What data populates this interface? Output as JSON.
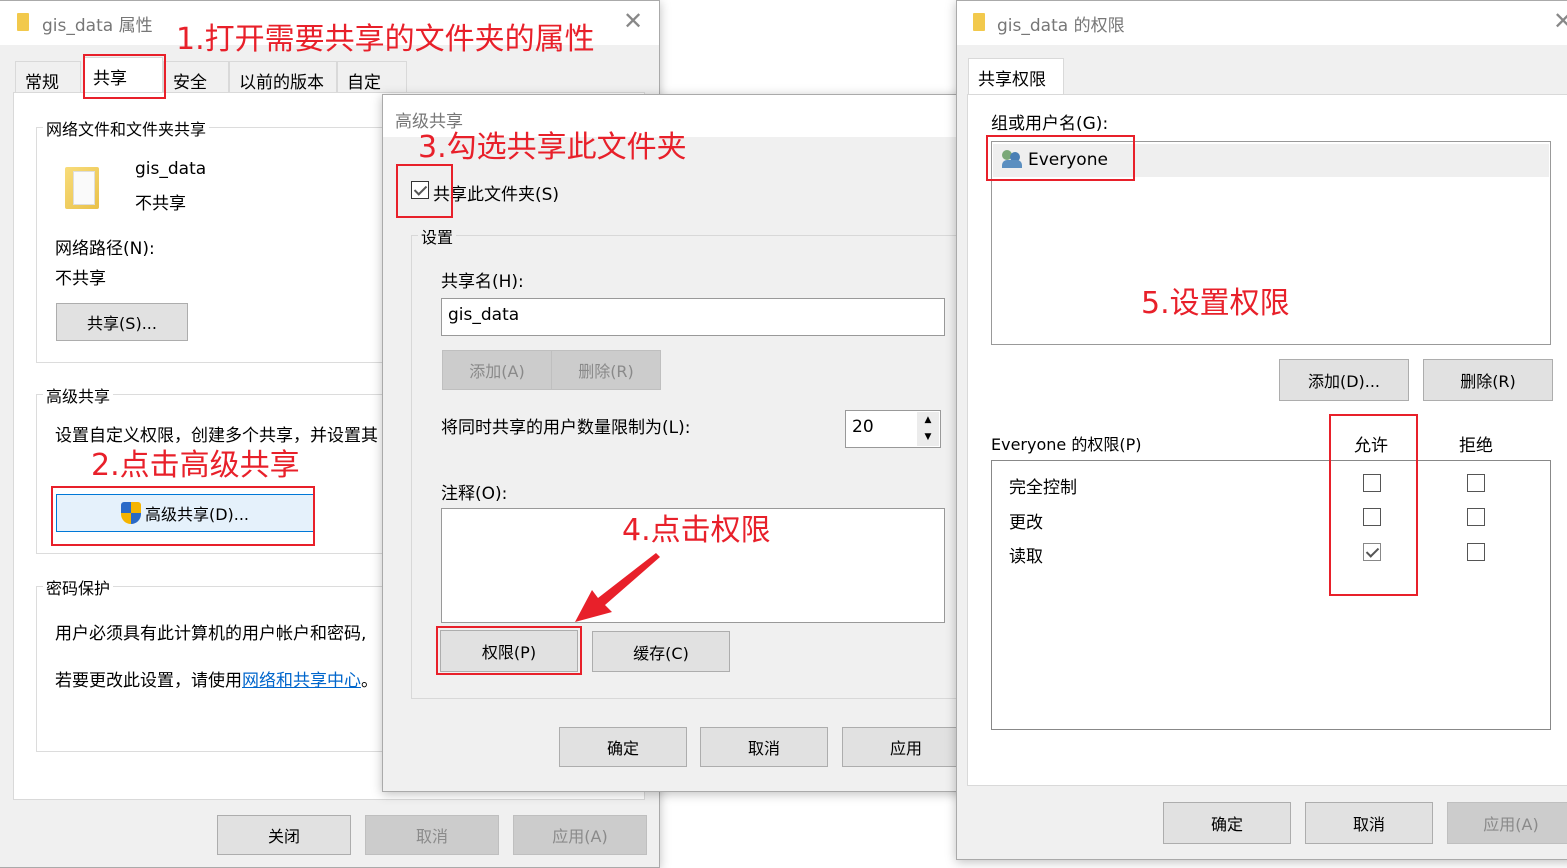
{
  "properties_window": {
    "title": "gis_data 属性",
    "close_glyph": "✕",
    "tabs": [
      {
        "label": "常规",
        "active": false
      },
      {
        "label": "共享",
        "active": true
      },
      {
        "label": "安全",
        "active": false
      },
      {
        "label": "以前的版本",
        "active": false
      },
      {
        "label": "自定义",
        "active": false
      }
    ],
    "network_sharing": {
      "group_label": "网络文件和文件夹共享",
      "folder_name": "gis_data",
      "folder_status": "不共享",
      "network_path_label": "网络路径(N):",
      "network_path_value": "不共享",
      "share_button": "共享(S)..."
    },
    "advanced_sharing": {
      "group_label": "高级共享",
      "description": "设置自定义权限，创建多个共享，并设置其",
      "button": "高级共享(D)..."
    },
    "password_protection": {
      "group_label": "密码保护",
      "line1": "用户必须具有此计算机的用户帐户和密码,",
      "line2_prefix": "若要更改此设置，请使用",
      "line2_link": "网络和共享中心",
      "line2_suffix": "。"
    },
    "footer": {
      "close": "关闭",
      "cancel": "取消",
      "apply": "应用(A)"
    }
  },
  "advanced_dialog": {
    "title": "高级共享",
    "share_checkbox_label": "共享此文件夹(S)",
    "share_checked": true,
    "settings_group": "设置",
    "share_name_label": "共享名(H):",
    "share_name_value": "gis_data",
    "add_button": "添加(A)",
    "remove_button": "删除(R)",
    "user_limit_label": "将同时共享的用户数量限制为(L):",
    "user_limit_value": "20",
    "comment_label": "注释(O):",
    "comment_value": "",
    "permissions_button": "权限(P)",
    "caching_button": "缓存(C)",
    "ok": "确定",
    "cancel": "取消",
    "apply": "应用"
  },
  "permissions_dialog": {
    "title": "gis_data 的权限",
    "tab": "共享权限",
    "group_label": "组或用户名(G):",
    "users": [
      "Everyone"
    ],
    "add_button": "添加(D)...",
    "remove_button": "删除(R)",
    "perm_label": "Everyone 的权限(P)",
    "allow_header": "允许",
    "deny_header": "拒绝",
    "permissions": [
      {
        "name": "完全控制",
        "allow": false,
        "deny": false
      },
      {
        "name": "更改",
        "allow": false,
        "deny": false
      },
      {
        "name": "读取",
        "allow": true,
        "deny": false
      }
    ],
    "ok": "确定",
    "cancel": "取消",
    "apply": "应用(A)"
  },
  "annotations": {
    "step1": "1.打开需要共享的文件夹的属性",
    "step2": "2.点击高级共享",
    "step3": "3.勾选共享此文件夹",
    "step4": "4.点击权限",
    "step5": "5.设置权限"
  },
  "colors": {
    "annotation_red": "#e8202a",
    "link_blue": "#0066cc",
    "dialog_bg": "#f0f0f0"
  }
}
